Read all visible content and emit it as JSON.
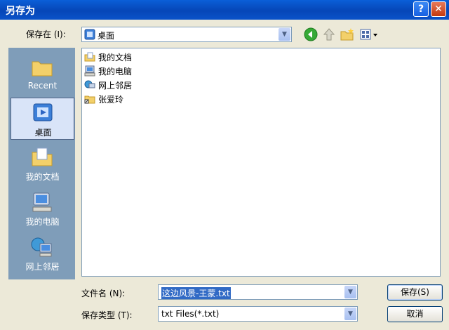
{
  "window": {
    "title": "另存为"
  },
  "titlebar": {
    "help_glyph": "?",
    "close_glyph": "✕"
  },
  "savein": {
    "label": "保存在 (I):",
    "value": "桌面"
  },
  "places": [
    {
      "label": "Recent"
    },
    {
      "label": "桌面"
    },
    {
      "label": "我的文档"
    },
    {
      "label": "我的电脑"
    },
    {
      "label": "网上邻居"
    }
  ],
  "files": [
    {
      "name": "我的文档"
    },
    {
      "name": "我的电脑"
    },
    {
      "name": "网上邻居"
    },
    {
      "name": "张爱玲"
    }
  ],
  "filename": {
    "label": "文件名 (N):",
    "value": "这边风景-王蒙.txt"
  },
  "filetype": {
    "label": "保存类型 (T):",
    "value": "txt Files(*.txt)"
  },
  "buttons": {
    "save": "保存(S)",
    "cancel": "取消"
  },
  "colors": {
    "titlebar": "#0646b7",
    "dialog_bg": "#ece9d8",
    "selection": "#316ac5"
  }
}
